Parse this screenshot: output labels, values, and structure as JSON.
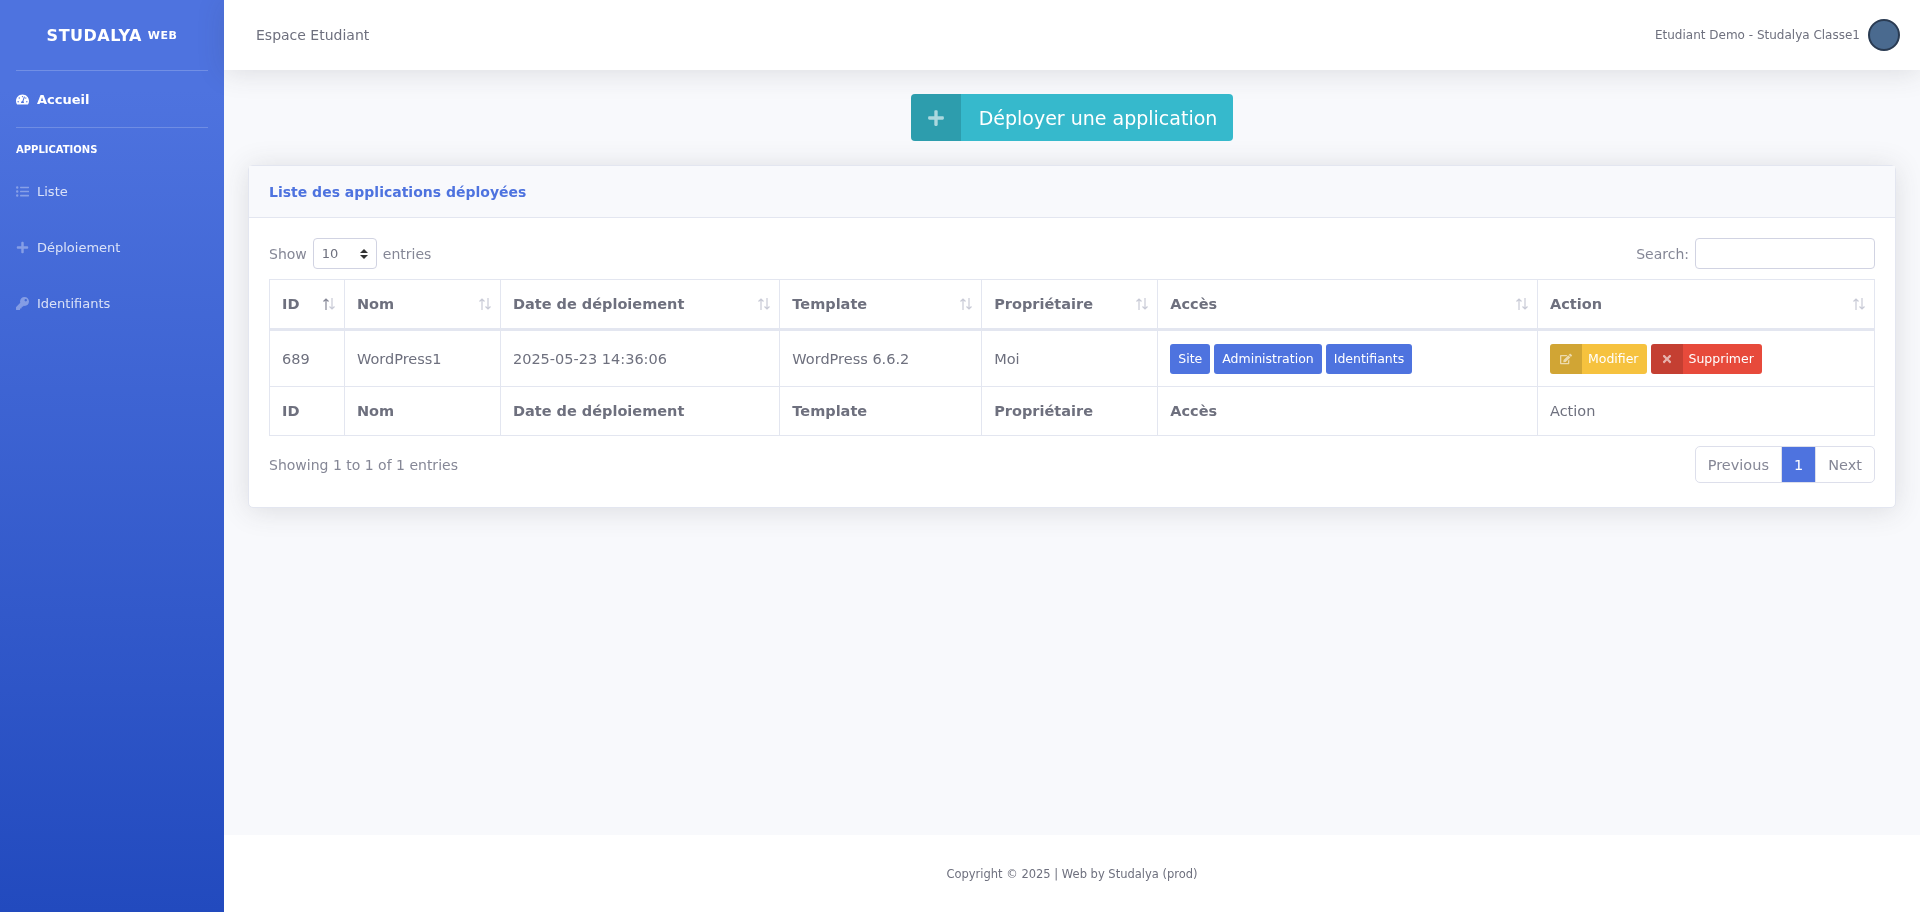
{
  "brand": {
    "name": "STUDALYA",
    "sup": "WEB"
  },
  "sidebar": {
    "top_items": [
      {
        "label": "Accueil",
        "active": true
      }
    ],
    "section": "APPLICATIONS",
    "items": [
      {
        "label": "Liste",
        "active": false
      },
      {
        "label": "Déploiement",
        "active": false
      },
      {
        "label": "Identifiants",
        "active": false
      }
    ]
  },
  "topbar": {
    "title": "Espace Etudiant",
    "user": "Etudiant Demo - Studalya Classe1"
  },
  "deploy_button": "Déployer une application",
  "card": {
    "title": "Liste des applications déployées",
    "show_label": "Show",
    "page_size": "10",
    "entries_label": "entries",
    "search_label": "Search:",
    "columns": [
      {
        "label": "ID",
        "sorted": true
      },
      {
        "label": "Nom",
        "sorted": false
      },
      {
        "label": "Date de déploiement",
        "sorted": false
      },
      {
        "label": "Template",
        "sorted": false
      },
      {
        "label": "Propriétaire",
        "sorted": false
      },
      {
        "label": "Accès",
        "sorted": false
      },
      {
        "label": "Action",
        "sorted": false
      }
    ],
    "rows": [
      {
        "id": "689",
        "nom": "WordPress1",
        "date": "2025-05-23 14:36:06",
        "template": "WordPress 6.6.2",
        "owner": "Moi",
        "access": [
          "Site",
          "Administration",
          "Identifiants"
        ],
        "actions": [
          {
            "label": "Modifier",
            "kind": "edit"
          },
          {
            "label": "Supprimer",
            "kind": "delete"
          }
        ]
      }
    ],
    "footer_cells": [
      {
        "label": "ID",
        "bold": true
      },
      {
        "label": "Nom",
        "bold": true
      },
      {
        "label": "Date de déploiement",
        "bold": true
      },
      {
        "label": "Template",
        "bold": true
      },
      {
        "label": "Propriétaire",
        "bold": true
      },
      {
        "label": "Accès",
        "bold": true
      },
      {
        "label": "Action",
        "bold": false
      }
    ],
    "info": "Showing 1 to 1 of 1 entries",
    "pagination": [
      {
        "label": "Previous",
        "selected": false
      },
      {
        "label": "1",
        "selected": true
      },
      {
        "label": "Next",
        "selected": false
      }
    ]
  },
  "footer": "Copyright © 2025 | Web by Studalya (prod)"
}
